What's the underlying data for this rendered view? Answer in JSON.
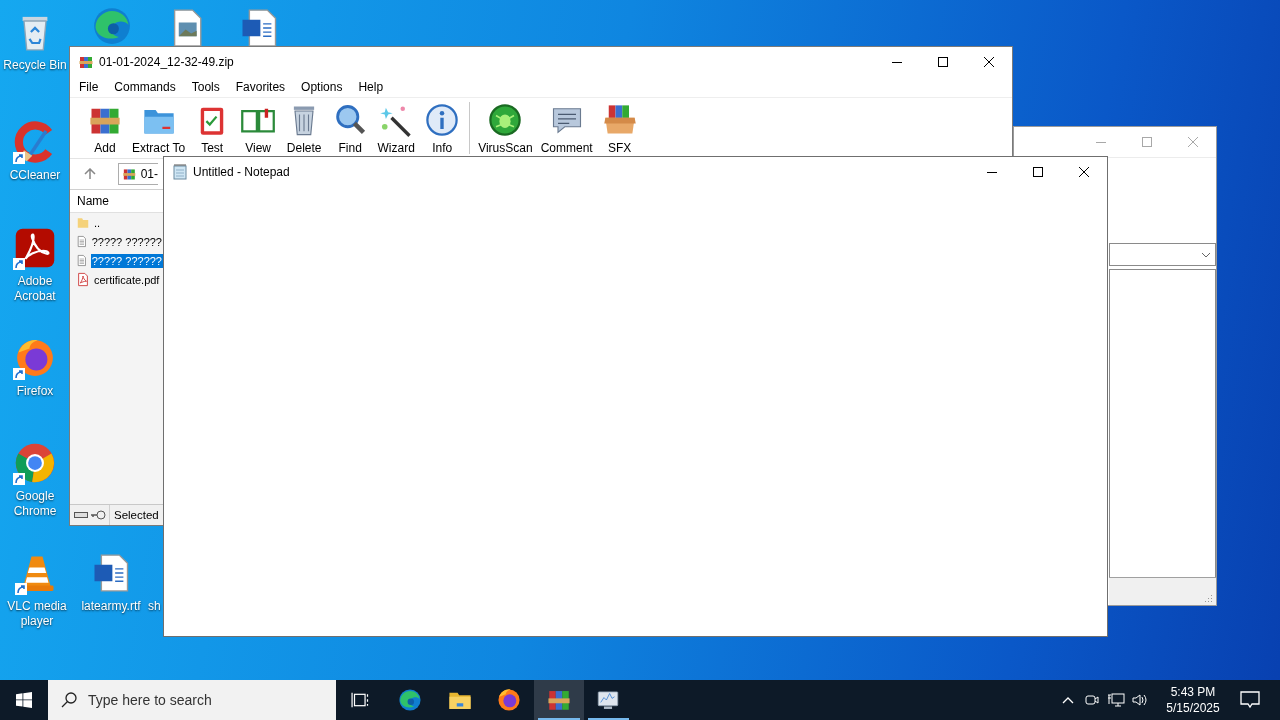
{
  "desktop": {
    "icons": [
      {
        "kind": "recycle-bin",
        "label": "Recycle Bin",
        "shortcut": false
      },
      {
        "kind": "edge",
        "shortcut": false
      },
      {
        "kind": "image-file",
        "shortcut": false
      },
      {
        "kind": "word-file",
        "shortcut": false
      },
      {
        "kind": "ccleaner",
        "label": "CCleaner",
        "shortcut": true
      },
      {
        "kind": "adobe",
        "label": "Adobe Acrobat",
        "shortcut": true
      },
      {
        "kind": "firefox",
        "label": "Firefox",
        "shortcut": true
      },
      {
        "kind": "chrome",
        "label": "Google Chrome",
        "shortcut": true
      },
      {
        "kind": "vlc",
        "label": "VLC media player",
        "shortcut": true
      },
      {
        "kind": "word-file",
        "label": "latearmy.rtf",
        "shortcut": false
      },
      {
        "kind": "label-only",
        "label": "sh"
      }
    ]
  },
  "winrar": {
    "title": "01-01-2024_12-32-49.zip",
    "menu": [
      "File",
      "Commands",
      "Tools",
      "Favorites",
      "Options",
      "Help"
    ],
    "toolbar_groups": [
      {
        "buttons": [
          {
            "kind": "add",
            "label": "Add"
          },
          {
            "kind": "extract",
            "label": "Extract To"
          },
          {
            "kind": "test",
            "label": "Test"
          },
          {
            "kind": "view",
            "label": "View"
          },
          {
            "kind": "delete",
            "label": "Delete"
          },
          {
            "kind": "find",
            "label": "Find"
          },
          {
            "kind": "wizard",
            "label": "Wizard"
          },
          {
            "kind": "info",
            "label": "Info"
          }
        ]
      },
      {
        "buttons": [
          {
            "kind": "virusscan",
            "label": "VirusScan"
          },
          {
            "kind": "comment",
            "label": "Comment"
          },
          {
            "kind": "sfx",
            "label": "SFX"
          }
        ]
      }
    ],
    "address": {
      "text": "01-"
    },
    "columns": [
      "Name"
    ],
    "files": [
      {
        "name": "..",
        "kind": "folder",
        "selected": false
      },
      {
        "name": "????? ??????",
        "kind": "text",
        "selected": false
      },
      {
        "name": "????? ??????",
        "kind": "text",
        "selected": true
      },
      {
        "name": "certificate.pdf",
        "kind": "pdf",
        "selected": false
      }
    ],
    "status": {
      "text": "Selected"
    }
  },
  "background_window": {
    "active": false
  },
  "notepad": {
    "title": "Untitled - Notepad",
    "active": true
  },
  "taskbar": {
    "search": {
      "placeholder": "Type here to search"
    },
    "apps": [
      {
        "kind": "task-view",
        "running": false,
        "selected": false
      },
      {
        "kind": "edge",
        "running": false,
        "selected": false
      },
      {
        "kind": "explorer",
        "running": false,
        "selected": false
      },
      {
        "kind": "firefox",
        "running": false,
        "selected": false
      },
      {
        "kind": "winrar",
        "running": true,
        "selected": true
      },
      {
        "kind": "monitor",
        "running": true,
        "selected": false
      }
    ],
    "clock": {
      "time": "5:43 PM",
      "date": "5/15/2025"
    }
  }
}
